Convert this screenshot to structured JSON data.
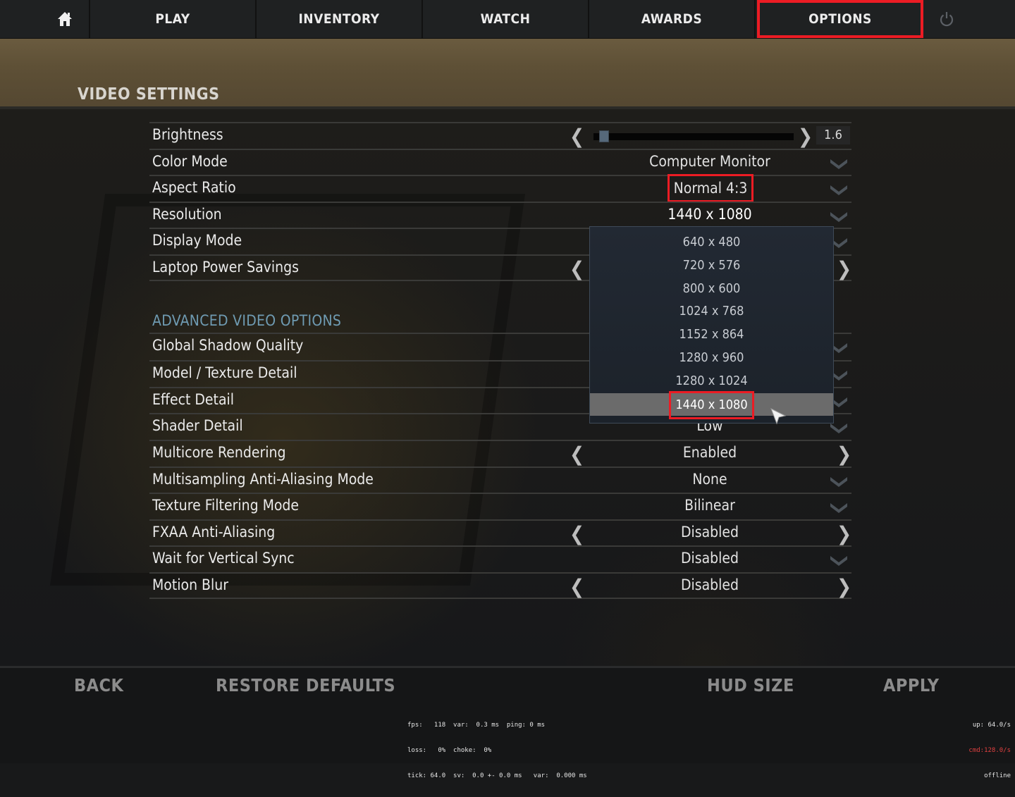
{
  "nav": {
    "home_icon": "home-icon",
    "tabs": [
      {
        "label": "PLAY"
      },
      {
        "label": "INVENTORY"
      },
      {
        "label": "WATCH"
      },
      {
        "label": "AWARDS"
      },
      {
        "label": "OPTIONS",
        "active": true
      }
    ],
    "power_icon": "power-icon"
  },
  "page": {
    "title": "VIDEO SETTINGS"
  },
  "settings": {
    "brightness": {
      "label": "Brightness",
      "value": "1.6",
      "slider_fraction": 0.03
    },
    "color_mode": {
      "label": "Color Mode",
      "value": "Computer Monitor"
    },
    "aspect_ratio": {
      "label": "Aspect Ratio",
      "value": "Normal 4:3"
    },
    "resolution": {
      "label": "Resolution",
      "value": "1440 x 1080"
    },
    "display_mode": {
      "label": "Display Mode",
      "value": ""
    },
    "laptop_power": {
      "label": "Laptop Power Savings",
      "value": ""
    },
    "advanced_title": "ADVANCED VIDEO OPTIONS",
    "global_shadow": {
      "label": "Global Shadow Quality",
      "value": ""
    },
    "model_texture": {
      "label": "Model / Texture Detail",
      "value": ""
    },
    "effect_detail": {
      "label": "Effect Detail",
      "value": ""
    },
    "shader_detail": {
      "label": "Shader Detail",
      "value": "Low"
    },
    "multicore": {
      "label": "Multicore Rendering",
      "value": "Enabled"
    },
    "msaa": {
      "label": "Multisampling Anti-Aliasing Mode",
      "value": "None"
    },
    "texture_filter": {
      "label": "Texture Filtering Mode",
      "value": "Bilinear"
    },
    "fxaa": {
      "label": "FXAA Anti-Aliasing",
      "value": "Disabled"
    },
    "vsync": {
      "label": "Wait for Vertical Sync",
      "value": "Disabled"
    },
    "motion_blur": {
      "label": "Motion Blur",
      "value": "Disabled"
    }
  },
  "resolution_dropdown": {
    "options": [
      "640 x 480",
      "720 x 576",
      "800 x 600",
      "1024 x 768",
      "1152 x 864",
      "1280 x 960",
      "1280 x 1024",
      "1440 x 1080"
    ],
    "selected": "1440 x 1080"
  },
  "footer": {
    "back": "BACK",
    "restore": "RESTORE DEFAULTS",
    "hud_size": "HUD SIZE",
    "apply": "APPLY"
  },
  "netgraph": {
    "line1": "fps:   118  var:  0.3 ms  ping: 0 ms",
    "line2": "loss:   0%  choke:  0%",
    "line3": "tick: 64.0  sv:  0.0 +- 0.0 ms   var:  0.000 ms",
    "up": "up: 64.0/s",
    "cmd": "cmd:128.0/s",
    "status": "offline"
  },
  "colors": {
    "highlight": "#ec1c24",
    "section": "#6f9bb2"
  }
}
